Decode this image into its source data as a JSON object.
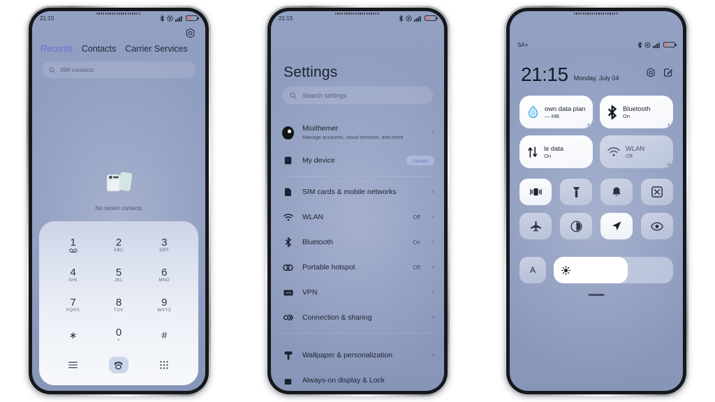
{
  "scene": {
    "background_color": "#ffffff",
    "screen_color": "#8e9cc0",
    "accent_color": "#6b6fd6"
  },
  "phone1": {
    "name": "Dialer / Contacts app",
    "statusbar": {
      "time": "21:15",
      "icons": [
        "bluetooth-icon",
        "alarm-icon",
        "signal-icon",
        "battery-icon"
      ]
    },
    "header": {
      "settings_icon": "gear-icon"
    },
    "tabs": [
      {
        "label": "Recents",
        "active": true
      },
      {
        "label": "Contacts",
        "active": false
      },
      {
        "label": "Carrier Services",
        "active": false
      }
    ],
    "search": {
      "placeholder": "398 contacts",
      "icon": "search-icon"
    },
    "empty_state": {
      "label": "No recent contacts",
      "icon": "contact-cards-illustration"
    },
    "keypad": {
      "keys": [
        {
          "num": "1",
          "sub": "☉☉"
        },
        {
          "num": "2",
          "sub": "ABC"
        },
        {
          "num": "3",
          "sub": "DEF"
        },
        {
          "num": "4",
          "sub": "GHI"
        },
        {
          "num": "5",
          "sub": "JKL"
        },
        {
          "num": "6",
          "sub": "MNO"
        },
        {
          "num": "7",
          "sub": "PQRS"
        },
        {
          "num": "8",
          "sub": "TUV"
        },
        {
          "num": "9",
          "sub": "WXYZ"
        },
        {
          "num": "∗",
          "sub": ""
        },
        {
          "num": "0",
          "sub": "+"
        },
        {
          "num": "#",
          "sub": ""
        }
      ],
      "actions": {
        "menu": "menu-icon",
        "call": "call-icon",
        "dialpad": "dialpad-icon"
      }
    }
  },
  "phone2": {
    "name": "Settings app",
    "statusbar": {
      "time": "21:15"
    },
    "title": "Settings",
    "search": {
      "placeholder": "Search settings",
      "icon": "search-icon"
    },
    "rows": [
      {
        "label": "Miuithemer",
        "sub": "Manage accounts, cloud services, and more",
        "icon": "account-avatar",
        "value": "",
        "chevron": true
      },
      {
        "label": "My device",
        "sub": "",
        "icon": "device-icon",
        "badge": "Update",
        "chevron": false
      },
      {
        "label": "SIM cards & mobile networks",
        "sub": "",
        "icon": "sim-card-icon",
        "value": "",
        "chevron": true
      },
      {
        "label": "WLAN",
        "sub": "",
        "icon": "wifi-icon",
        "value": "Off",
        "chevron": true
      },
      {
        "label": "Bluetooth",
        "sub": "",
        "icon": "bluetooth-icon",
        "value": "On",
        "chevron": true
      },
      {
        "label": "Portable hotspot",
        "sub": "",
        "icon": "hotspot-icon",
        "value": "Off",
        "chevron": true
      },
      {
        "label": "VPN",
        "sub": "",
        "icon": "vpn-icon",
        "value": "",
        "chevron": true
      },
      {
        "label": "Connection & sharing",
        "sub": "",
        "icon": "connection-sharing-icon",
        "value": "",
        "chevron": true
      },
      {
        "label": "Wallpaper & personalization",
        "sub": "",
        "icon": "wallpaper-icon",
        "value": "",
        "chevron": true
      },
      {
        "label": "Always-on display & Lock",
        "sub": "",
        "icon": "aod-lock-icon",
        "value": "",
        "chevron": false
      }
    ]
  },
  "phone3": {
    "name": "Control center",
    "statusbar": {
      "network": "SA+",
      "icons": [
        "bluetooth-icon",
        "alarm-icon",
        "signal-icon",
        "battery-icon"
      ]
    },
    "clock": {
      "time": "21:15",
      "date": "Monday, July 04"
    },
    "header_actions": [
      {
        "name": "settings-icon"
      },
      {
        "name": "edit-icon"
      }
    ],
    "big_tiles": [
      {
        "title": "own data plan",
        "state": "— MB",
        "icon": "data-usage-icon",
        "on": true
      },
      {
        "title": "Bluetooth",
        "state": "On",
        "icon": "bluetooth-icon",
        "on": true
      },
      {
        "title": "le data",
        "state": "On",
        "icon": "mobile-data-icon",
        "on": true
      },
      {
        "title": "WLAN",
        "state": "Off",
        "icon": "wifi-icon",
        "on": false
      }
    ],
    "small_tiles": [
      {
        "name": "vibrate-icon",
        "active": true
      },
      {
        "name": "flashlight-icon",
        "active": false
      },
      {
        "name": "sound-bell-icon",
        "active": false
      },
      {
        "name": "screenshot-icon",
        "active": false
      },
      {
        "name": "airplane-mode-icon",
        "active": false
      },
      {
        "name": "dark-mode-icon",
        "active": false
      },
      {
        "name": "location-icon",
        "active": true
      },
      {
        "name": "reading-mode-eye-icon",
        "active": false
      }
    ],
    "brightness": {
      "auto_label": "A",
      "icon": "brightness-sun-icon",
      "level_percent": 62
    },
    "drag_handle": "drag-handle"
  }
}
